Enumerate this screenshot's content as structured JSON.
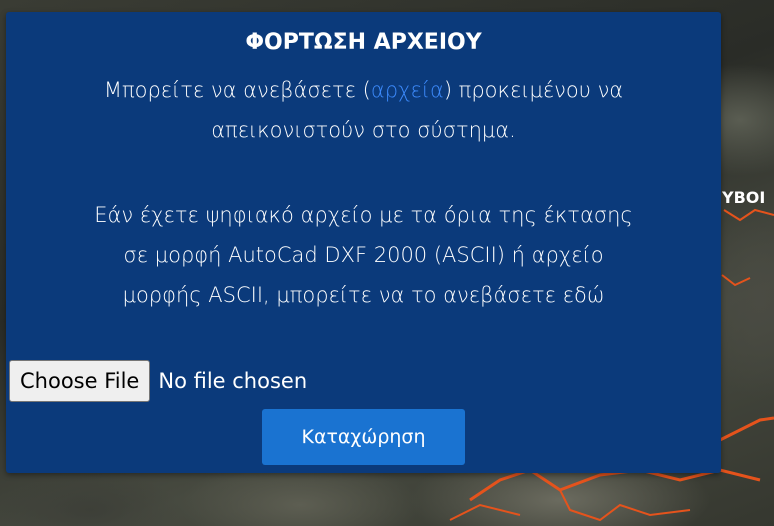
{
  "dialog": {
    "title": "ΦΟΡΤΩΣΗ ΑΡΧΕΙΟΥ",
    "intro_before": "Μπορείτε να ανεβάσετε (",
    "intro_link": "αρχεία",
    "intro_after": ") προκειμένου να",
    "intro_line2": "απεικονιστούν στο σύστημα.",
    "info_line1": "Εάν έχετε ψηφιακό αρχείο με τα όρια της έκτασης",
    "info_line2": "σε μορφή AutoCad DXF 2000 (ASCII) ή αρχείο",
    "info_line3": "μορφής ASCII, μπορείτε να το ανεβάσετε εδώ",
    "file_input": {
      "button_label": "Choose File",
      "status": "No file chosen"
    },
    "submit_label": "Καταχώρηση"
  },
  "map": {
    "label": "ΥΒΟΙ",
    "boundary_color": "#e5531c"
  }
}
